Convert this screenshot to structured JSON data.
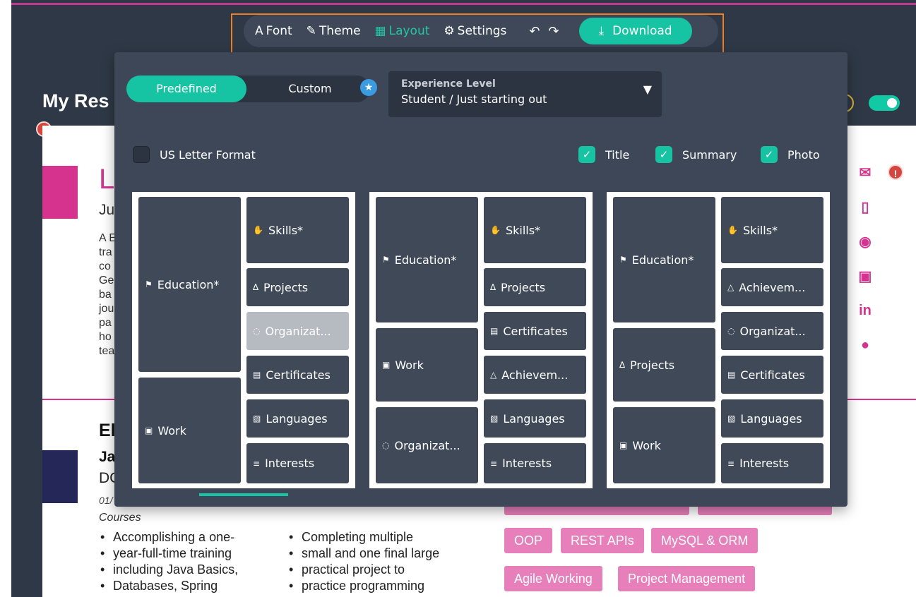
{
  "toolbar": {
    "items": [
      {
        "label": "Font",
        "icon": "font-icon",
        "glyph": "A"
      },
      {
        "label": "Theme",
        "icon": "theme-brush-icon",
        "glyph": "✎"
      },
      {
        "label": "Layout",
        "icon": "layout-icon",
        "glyph": "▦",
        "active": true
      },
      {
        "label": "Settings",
        "icon": "settings-gear-icon",
        "glyph": "⚙"
      }
    ],
    "undo_glyph": "↶",
    "redo_glyph": "↷",
    "download_label": "Download",
    "download_glyph": "⤓"
  },
  "background_page": {
    "title": "My Res",
    "name_letter": "L",
    "sub_letter": "Ju",
    "summary_fragments": [
      "A E",
      "tra",
      "co",
      "Ge",
      "ba",
      "jou",
      "pa",
      "ho",
      "tea"
    ],
    "experience_heading": "El",
    "job_title": "Ja",
    "job_org": "DC",
    "job_date": "01/",
    "courses_label": "Courses",
    "bullets_col1": [
      "Accomplishing a one-",
      "year-full-time training",
      "including Java Basics,",
      "Databases, Spring"
    ],
    "bullets_col2": [
      "Completing multiple",
      "small and one final large",
      "practical project to",
      "practice programming"
    ],
    "skill_tags": [
      "OOP",
      "REST APIs",
      "MySQL & ORM",
      "Agile Working",
      "Project Management"
    ],
    "error_glyph": "!"
  },
  "panel": {
    "segment": {
      "predefined": "Predefined",
      "custom": "Custom"
    },
    "star_glyph": "★",
    "experience": {
      "label": "Experience Level",
      "value": "Student / Just starting out",
      "caret": "▼"
    },
    "us_letter_label": "US Letter Format",
    "toggles": [
      {
        "label": "Title",
        "checked": true
      },
      {
        "label": "Summary",
        "checked": true
      },
      {
        "label": "Photo",
        "checked": true
      }
    ],
    "check_glyph": "✓",
    "layouts": [
      {
        "blocks": [
          {
            "label": "Education*",
            "icon": "⚑"
          },
          {
            "label": "Work",
            "icon": "▣"
          },
          {
            "label": "Skills*",
            "icon": "✋"
          },
          {
            "label": "Projects",
            "icon": "∆"
          },
          {
            "label": "Organizat...",
            "icon": "◌",
            "dim": true
          },
          {
            "label": "Certificates",
            "icon": "▤"
          },
          {
            "label": "Languages",
            "icon": "▧"
          },
          {
            "label": "Interests",
            "icon": "≡"
          }
        ]
      },
      {
        "blocks": [
          {
            "label": "Education*",
            "icon": "⚑"
          },
          {
            "label": "Work",
            "icon": "▣"
          },
          {
            "label": "Organizat...",
            "icon": "◌"
          },
          {
            "label": "Skills*",
            "icon": "✋"
          },
          {
            "label": "Projects",
            "icon": "∆"
          },
          {
            "label": "Certificates",
            "icon": "▤"
          },
          {
            "label": "Achievem...",
            "icon": "△"
          },
          {
            "label": "Languages",
            "icon": "▧"
          },
          {
            "label": "Interests",
            "icon": "≡"
          }
        ]
      },
      {
        "blocks": [
          {
            "label": "Education*",
            "icon": "⚑"
          },
          {
            "label": "Projects",
            "icon": "∆"
          },
          {
            "label": "Work",
            "icon": "▣"
          },
          {
            "label": "Skills*",
            "icon": "✋"
          },
          {
            "label": "Achievem...",
            "icon": "△"
          },
          {
            "label": "Organizat...",
            "icon": "◌"
          },
          {
            "label": "Certificates",
            "icon": "▤"
          },
          {
            "label": "Languages",
            "icon": "▧"
          },
          {
            "label": "Interests",
            "icon": "≡"
          }
        ]
      }
    ]
  },
  "contact_icons": [
    {
      "name": "email-icon",
      "glyph": "✉"
    },
    {
      "name": "phone-icon",
      "glyph": "▯"
    },
    {
      "name": "location-pin-icon",
      "glyph": "◉"
    },
    {
      "name": "website-icon",
      "glyph": "▣"
    },
    {
      "name": "linkedin-icon",
      "glyph": "in"
    },
    {
      "name": "github-icon",
      "glyph": "●"
    }
  ],
  "colors": {
    "accent": "#16c3a3",
    "brand_pink": "#d6338f",
    "panel_bg": "#3d4757",
    "highlight_outline": "#ec7d22"
  }
}
